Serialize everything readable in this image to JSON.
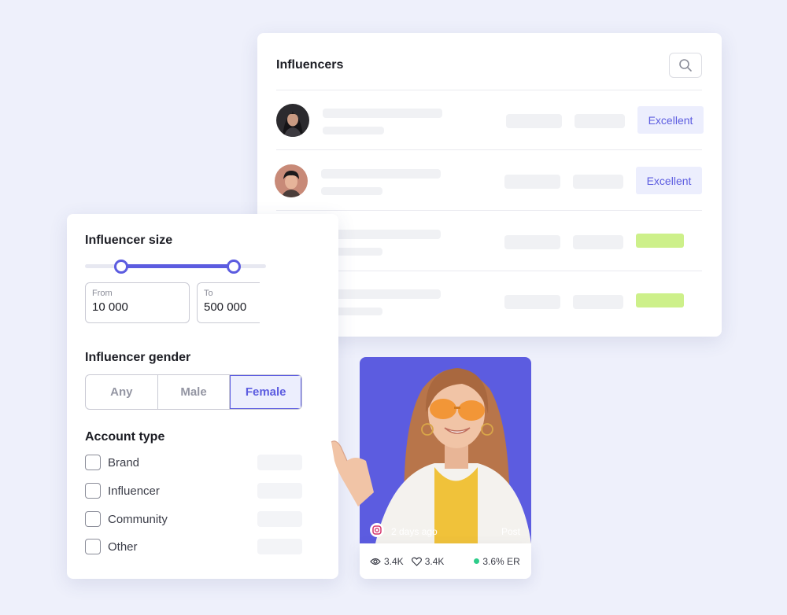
{
  "filters": {
    "size": {
      "title": "Influencer size",
      "from_label": "From",
      "from_value": "10 000",
      "to_label": "To",
      "to_value": "500 000"
    },
    "gender": {
      "title": "Influencer gender",
      "options": [
        "Any",
        "Male",
        "Female"
      ],
      "selected": "Female"
    },
    "account_type": {
      "title": "Account type",
      "options": [
        "Brand",
        "Influencer",
        "Community",
        "Other"
      ]
    }
  },
  "influencers": {
    "title": "Influencers",
    "rows": [
      {
        "badge": "Excellent"
      },
      {
        "badge": "Excellent"
      },
      {
        "badge": ""
      },
      {
        "badge": ""
      }
    ]
  },
  "post": {
    "time": "2 days ago",
    "type": "Post",
    "views": "3.4K",
    "likes": "3.4K",
    "er": "3.6% ER"
  },
  "colors": {
    "accent": "#5c5ce0",
    "background": "#eef0fb",
    "quality_good": "#cdf08a",
    "er_dot": "#2ecc8a"
  },
  "icons": {
    "search": "search-icon",
    "instagram": "instagram-icon",
    "views": "eye-icon",
    "likes": "heart-icon"
  }
}
